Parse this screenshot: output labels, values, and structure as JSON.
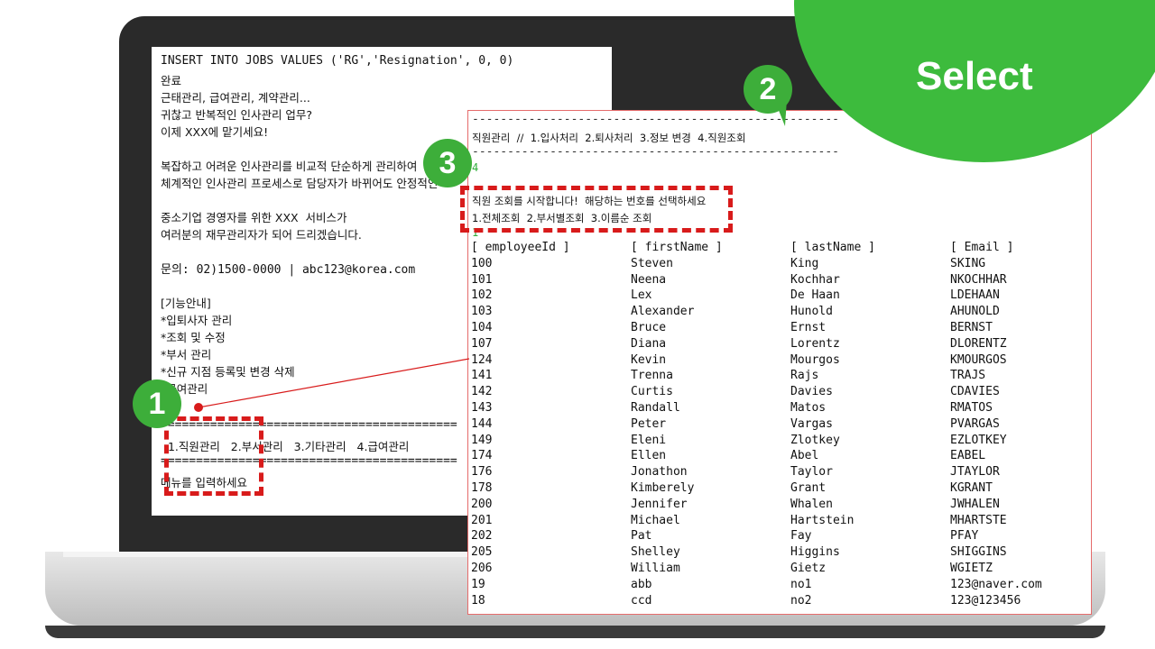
{
  "left_console": {
    "lines": [
      "INSERT INTO JOBS VALUES ('RG','Resignation', 0, 0)",
      "완료",
      "근태관리, 급여관리, 계약관리...",
      "귀찮고 반복적인 인사관리 업무?",
      "이제 XXX에 맡기세요!",
      "",
      "복잡하고 어려운 인사관리를 비교적 단순하게 관리하여",
      "체계적인 인사관리 프로세스로 담당자가 바뀌어도 안정적인",
      "",
      "중소기업 경영자를 위한 XXX  서비스가",
      "여러분의 재무관리자가 되어 드리겠습니다.",
      "",
      "문의: 02)1500-0000 | abc123@korea.com",
      "",
      "[기능안내]",
      "*입퇴사자 관리",
      "*조회 및 수정",
      "*부서 관리",
      "*신규 지점 등록및 변경 삭제",
      "*급여관리"
    ],
    "separator": "==========================================",
    "menu": "  1.직원관리   2.부서관리   3.기타관리   4.급여관리",
    "prompt": "메뉴를 입력하세요"
  },
  "right_window": {
    "dash_line": "----------------------------------------------------",
    "menu_line": "직원관리  //  1.입사처리  2.퇴사처리  3.정보 변경  4.직원조회",
    "input_4": "4",
    "msg_line1": "직원 조회를 시작합니다!  해당하는 번호를 선택하세요",
    "msg_line2": "1.전체조회  2.부서별조회  3.이름순 조회",
    "input_1": "1",
    "headers": [
      "[ employeeId ]",
      "[ firstName ]",
      "[ lastName ]",
      "[ Email ]"
    ],
    "rows": [
      [
        "100",
        "Steven",
        "King",
        "SKING"
      ],
      [
        "101",
        "Neena",
        "Kochhar",
        "NKOCHHAR"
      ],
      [
        "102",
        "Lex",
        "De Haan",
        "LDEHAAN"
      ],
      [
        "103",
        "Alexander",
        "Hunold",
        "AHUNOLD"
      ],
      [
        "104",
        "Bruce",
        "Ernst",
        "BERNST"
      ],
      [
        "107",
        "Diana",
        "Lorentz",
        "DLORENTZ"
      ],
      [
        "124",
        "Kevin",
        "Mourgos",
        "KMOURGOS"
      ],
      [
        "141",
        "Trenna",
        "Rajs",
        "TRAJS"
      ],
      [
        "142",
        "Curtis",
        "Davies",
        "CDAVIES"
      ],
      [
        "143",
        "Randall",
        "Matos",
        "RMATOS"
      ],
      [
        "144",
        "Peter",
        "Vargas",
        "PVARGAS"
      ],
      [
        "149",
        "Eleni",
        "Zlotkey",
        "EZLOTKEY"
      ],
      [
        "174",
        "Ellen",
        "Abel",
        "EABEL"
      ],
      [
        "176",
        "Jonathon",
        "Taylor",
        "JTAYLOR"
      ],
      [
        "178",
        "Kimberely",
        "Grant",
        "KGRANT"
      ],
      [
        "200",
        "Jennifer",
        "Whalen",
        "JWHALEN"
      ],
      [
        "201",
        "Michael",
        "Hartstein",
        "MHARTSTE"
      ],
      [
        "202",
        "Pat",
        "Fay",
        "PFAY"
      ],
      [
        "205",
        "Shelley",
        "Higgins",
        "SHIGGINS"
      ],
      [
        "206",
        "William",
        "Gietz",
        "WGIETZ"
      ],
      [
        "19",
        "abb",
        "no1",
        "123@naver.com"
      ],
      [
        "18",
        "ccd",
        "no2",
        "123@123456"
      ]
    ]
  },
  "callouts": {
    "one": "1",
    "two": "2",
    "three": "3"
  },
  "banner": {
    "label": "Select"
  },
  "colors": {
    "accent_green": "#3dbb3d",
    "badge_green": "#3dae3a",
    "highlight_red": "#d81b1b"
  }
}
